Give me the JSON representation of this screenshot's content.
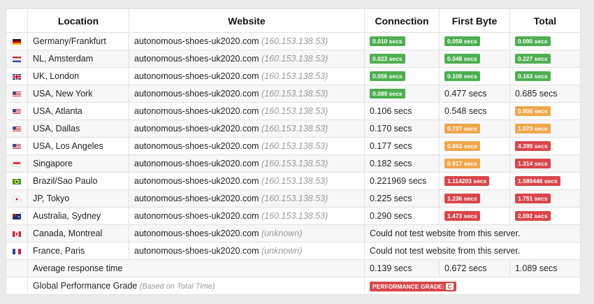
{
  "headers": {
    "location": "Location",
    "website": "Website",
    "connection": "Connection",
    "first_byte": "First Byte",
    "total": "Total"
  },
  "rows": [
    {
      "flag": "germany-flag",
      "location": "Germany/Frankfurt",
      "site": "autonomous-shoes-uk2020.com",
      "ip": "(160.153.138.53)",
      "conn": "0.010 secs",
      "conn_badge": "green",
      "fb": "0.059 secs",
      "fb_badge": "green",
      "total": "0.090 secs",
      "total_badge": "green"
    },
    {
      "flag": "netherlands-flag",
      "location": "NL, Amsterdam",
      "site": "autonomous-shoes-uk2020.com",
      "ip": "(160.153.138.53)",
      "conn": "0.023 secs",
      "conn_badge": "green",
      "fb": "0.048 secs",
      "fb_badge": "green",
      "total": "0.227 secs",
      "total_badge": "green"
    },
    {
      "flag": "uk-flag",
      "location": "UK, London",
      "site": "autonomous-shoes-uk2020.com",
      "ip": "(160.153.138.53)",
      "conn": "0.056 secs",
      "conn_badge": "green",
      "fb": "0.108 secs",
      "fb_badge": "green",
      "total": "0.163 secs",
      "total_badge": "green"
    },
    {
      "flag": "usa-flag",
      "location": "USA, New York",
      "site": "autonomous-shoes-uk2020.com",
      "ip": "(160.153.138.53)",
      "conn": "0.089 secs",
      "conn_badge": "green",
      "fb": "0.477 secs",
      "fb_badge": "",
      "total": "0.685 secs",
      "total_badge": ""
    },
    {
      "flag": "usa-flag",
      "location": "USA, Atlanta",
      "site": "autonomous-shoes-uk2020.com",
      "ip": "(160.153.138.53)",
      "conn": "0.106 secs",
      "conn_badge": "",
      "fb": "0.548 secs",
      "fb_badge": "",
      "total": "0.906 secs",
      "total_badge": "orange"
    },
    {
      "flag": "usa-flag",
      "location": "USA, Dallas",
      "site": "autonomous-shoes-uk2020.com",
      "ip": "(160.153.138.53)",
      "conn": "0.170 secs",
      "conn_badge": "",
      "fb": "0.727 secs",
      "fb_badge": "orange",
      "total": "1.073 secs",
      "total_badge": "orange"
    },
    {
      "flag": "usa-flag",
      "location": "USA, Los Angeles",
      "site": "autonomous-shoes-uk2020.com",
      "ip": "(160.153.138.53)",
      "conn": "0.177 secs",
      "conn_badge": "",
      "fb": "0.863 secs",
      "fb_badge": "orange",
      "total": "4.399 secs",
      "total_badge": "red"
    },
    {
      "flag": "singapore-flag",
      "location": "Singapore",
      "site": "autonomous-shoes-uk2020.com",
      "ip": "(160.153.138.53)",
      "conn": "0.182 secs",
      "conn_badge": "",
      "fb": "0.917 secs",
      "fb_badge": "orange",
      "total": "1.314 secs",
      "total_badge": "red"
    },
    {
      "flag": "brazil-flag",
      "location": "Brazil/Sao Paulo",
      "site": "autonomous-shoes-uk2020.com",
      "ip": "(160.153.138.53)",
      "conn": "0.221969 secs",
      "conn_badge": "",
      "fb": "1.114203 secs",
      "fb_badge": "red",
      "total": "1.589446 secs",
      "total_badge": "red"
    },
    {
      "flag": "japan-flag",
      "location": "JP, Tokyo",
      "site": "autonomous-shoes-uk2020.com",
      "ip": "(160.153.138.53)",
      "conn": "0.225 secs",
      "conn_badge": "",
      "fb": "1.236 secs",
      "fb_badge": "red",
      "total": "1.751 secs",
      "total_badge": "red"
    },
    {
      "flag": "australia-flag",
      "location": "Australia, Sydney",
      "site": "autonomous-shoes-uk2020.com",
      "ip": "(160.153.138.53)",
      "conn": "0.290 secs",
      "conn_badge": "",
      "fb": "1.473 secs",
      "fb_badge": "red",
      "total": "2.092 secs",
      "total_badge": "red"
    }
  ],
  "failed_rows": [
    {
      "flag": "canada-flag",
      "location": "Canada, Montreal",
      "site": "autonomous-shoes-uk2020.com",
      "ip": "(unknown)",
      "message": "Could not test website from this server."
    },
    {
      "flag": "france-flag",
      "location": "France, Paris",
      "site": "autonomous-shoes-uk2020.com",
      "ip": "(unknown)",
      "message": "Could not test website from this server."
    }
  ],
  "average": {
    "label": "Average response time",
    "conn": "0.139 secs",
    "fb": "0.672 secs",
    "total": "1.089 secs"
  },
  "grade": {
    "label": "Global Performance Grade",
    "sublabel": "(Based on Total Time)",
    "badge_text": "PERFORMANCE GRADE:",
    "letter": "C"
  },
  "colors": {
    "green": "#4caf50",
    "orange": "#f0a64a",
    "red": "#d9464a"
  }
}
